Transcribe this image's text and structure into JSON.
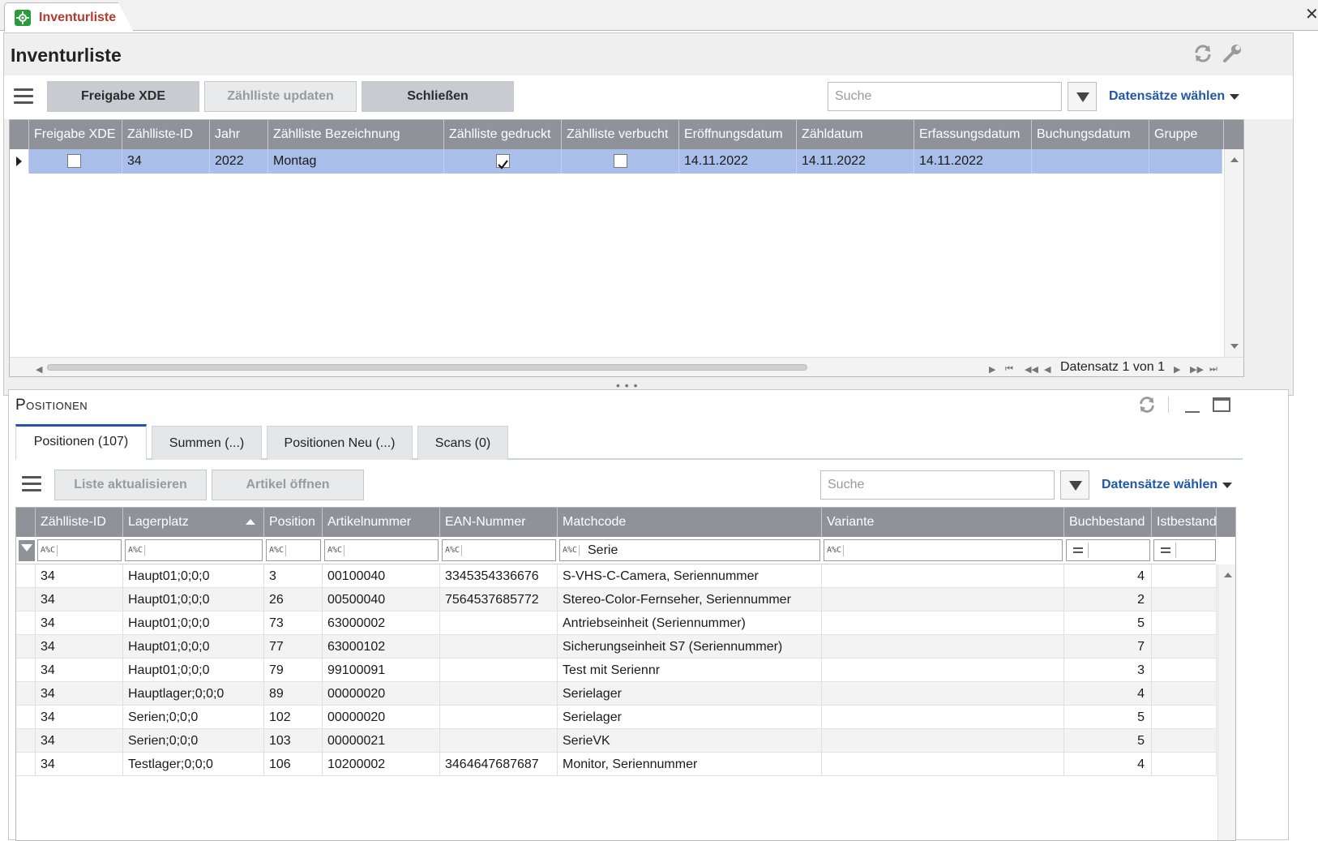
{
  "window": {
    "tab_title": "Inventurliste",
    "close_glyph": "✕"
  },
  "top_panel": {
    "title": "Inventurliste",
    "icons": [
      "refresh-icon",
      "wrench-icon"
    ],
    "toolbar": {
      "btn_release": "Freigabe XDE",
      "btn_update": "Zählliste updaten",
      "btn_close": "Schließen",
      "search_placeholder": "Suche",
      "records_label": "Datensätze wählen"
    },
    "grid": {
      "columns": [
        "Freigabe XDE",
        "Zählliste-ID",
        "Jahr",
        "Zählliste Bezeichnung",
        "Zählliste gedruckt",
        "Zählliste verbucht",
        "Eröffnungsdatum",
        "Zähldatum",
        "Erfassungsdatum",
        "Buchungsdatum",
        "Gruppe"
      ],
      "row": {
        "freigabe_xde": false,
        "id": "34",
        "jahr": "2022",
        "bezeichnung": "Montag",
        "gedruckt": true,
        "verbucht": false,
        "eroeffnung": "14.11.2022",
        "zaehldatum": "14.11.2022",
        "erfassung": "14.11.2022",
        "buchung": "",
        "gruppe": ""
      },
      "record_info": "Datensatz 1 von 1"
    }
  },
  "bottom_panel": {
    "title": "Positionen",
    "tabs": [
      "Positionen (107)",
      "Summen (...)",
      "Positionen Neu (...)",
      "Scans (0)"
    ],
    "active_tab": 0,
    "toolbar": {
      "btn_refresh": "Liste aktualisieren",
      "btn_open": "Artikel öffnen",
      "search_placeholder": "Suche",
      "records_label": "Datensätze wählen"
    },
    "grid": {
      "columns": [
        "Zählliste-ID",
        "Lagerplatz",
        "Position",
        "Artikelnummer",
        "EAN-Nummer",
        "Matchcode",
        "Variante",
        "Buchbestand",
        "Istbestand"
      ],
      "filter_matchcode": "Serie",
      "rows": [
        {
          "id": "34",
          "lagerplatz": "Haupt01;0;0;0",
          "position": "3",
          "artikel": "00100040",
          "ean": "3345354336676",
          "matchcode": "S-VHS-C-Camera, Seriennummer",
          "variante": "",
          "buch": "4",
          "ist": ""
        },
        {
          "id": "34",
          "lagerplatz": "Haupt01;0;0;0",
          "position": "26",
          "artikel": "00500040",
          "ean": "7564537685772",
          "matchcode": "Stereo-Color-Fernseher, Seriennummer",
          "variante": "",
          "buch": "2",
          "ist": ""
        },
        {
          "id": "34",
          "lagerplatz": "Haupt01;0;0;0",
          "position": "73",
          "artikel": "63000002",
          "ean": "",
          "matchcode": "Antriebseinheit (Seriennummer)",
          "variante": "",
          "buch": "5",
          "ist": ""
        },
        {
          "id": "34",
          "lagerplatz": "Haupt01;0;0;0",
          "position": "77",
          "artikel": "63000102",
          "ean": "",
          "matchcode": "Sicherungseinheit S7 (Seriennummer)",
          "variante": "",
          "buch": "7",
          "ist": ""
        },
        {
          "id": "34",
          "lagerplatz": "Haupt01;0;0;0",
          "position": "79",
          "artikel": "99100091",
          "ean": "",
          "matchcode": "Test mit Seriennr",
          "variante": "",
          "buch": "3",
          "ist": ""
        },
        {
          "id": "34",
          "lagerplatz": "Hauptlager;0;0;0",
          "position": "89",
          "artikel": "00000020",
          "ean": "",
          "matchcode": "Serielager",
          "variante": "",
          "buch": "4",
          "ist": ""
        },
        {
          "id": "34",
          "lagerplatz": "Serien;0;0;0",
          "position": "102",
          "artikel": "00000020",
          "ean": "",
          "matchcode": "Serielager",
          "variante": "",
          "buch": "5",
          "ist": ""
        },
        {
          "id": "34",
          "lagerplatz": "Serien;0;0;0",
          "position": "103",
          "artikel": "00000021",
          "ean": "",
          "matchcode": "SerieVK",
          "variante": "",
          "buch": "5",
          "ist": ""
        },
        {
          "id": "34",
          "lagerplatz": "Testlager;0;0;0",
          "position": "106",
          "artikel": "10200002",
          "ean": "3464647687687",
          "matchcode": "Monitor, Seriennummer",
          "variante": "",
          "buch": "4",
          "ist": ""
        }
      ]
    }
  },
  "colors": {
    "accent": "#2057a8",
    "tab_title": "#b33a2e",
    "grid_header": "#8f9399",
    "selected_row": "#a9bee8"
  }
}
